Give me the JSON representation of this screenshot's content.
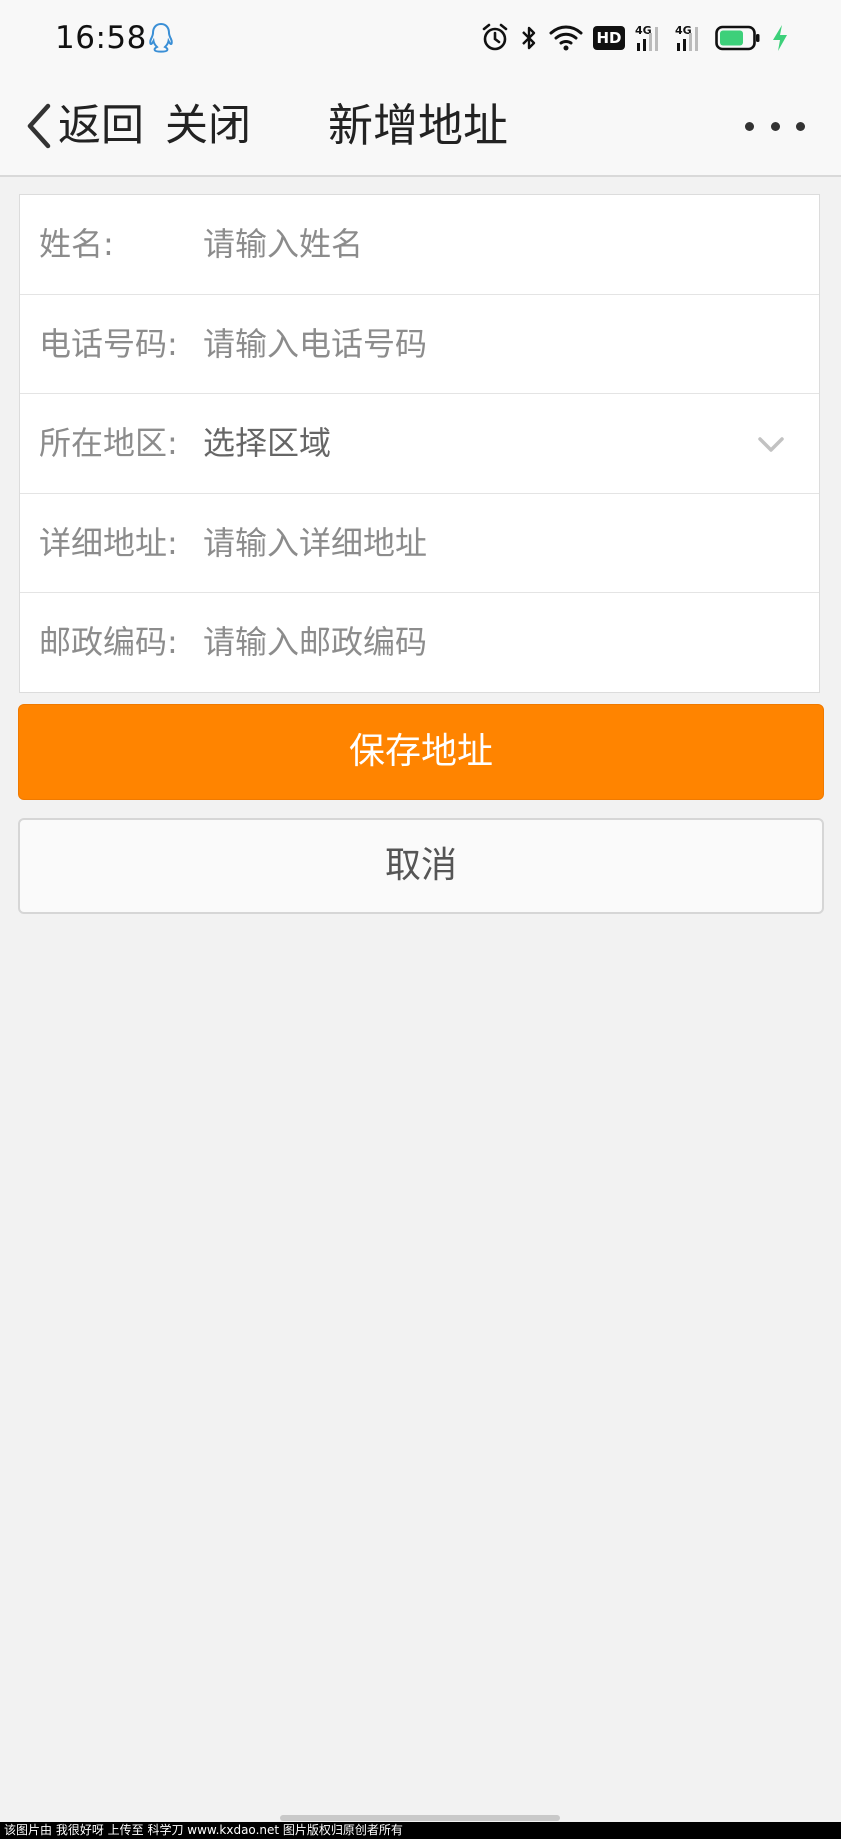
{
  "status_bar": {
    "time": "16:58",
    "hd_badge": "HD",
    "signal_1_label": "4G",
    "signal_2_label": "4G",
    "icons": [
      "qq-icon",
      "alarm-icon",
      "bluetooth-icon",
      "wifi-icon",
      "hd-icon",
      "signal-icon",
      "signal-icon",
      "battery-icon",
      "charging-icon"
    ],
    "accent_battery_color": "#3dd07a"
  },
  "header": {
    "back_label": "返回",
    "close_label": "关闭",
    "title": "新增地址"
  },
  "form": {
    "name": {
      "label": "姓名:",
      "placeholder": "请输入姓名"
    },
    "phone": {
      "label": "电话号码:",
      "placeholder": "请输入电话号码"
    },
    "region": {
      "label": "所在地区:",
      "value": "选择区域"
    },
    "address": {
      "label": "详细地址:",
      "placeholder": "请输入详细地址"
    },
    "postcode": {
      "label": "邮政编码:",
      "placeholder": "请输入邮政编码"
    }
  },
  "buttons": {
    "save_label": "保存地址",
    "save_color": "#ff8400",
    "cancel_label": "取消"
  },
  "watermark": "该图片由 我很好呀 上传至 科学刀 www.kxdao.net 图片版权归原创者所有"
}
